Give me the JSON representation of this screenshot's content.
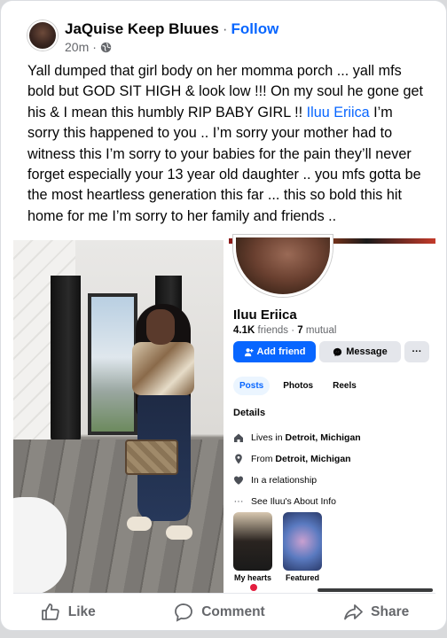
{
  "post": {
    "author": "JaQuise Keep Bluues",
    "separator": "·",
    "follow_label": "Follow",
    "time": "20m",
    "time_sep": "·",
    "text_before": "Yall dumped that girl body on her momma porch ... yall mfs bold but GOD SIT HIGH & look low !!! On my soul he gone get his & I mean this humbly RIP BABY GIRL !! ",
    "mention": "Iluu Eriica",
    "text_after": " I’m sorry this happened to you .. I’m sorry your mother had to witness this I’m sorry to your babies for the pain they’ll never forget especially your 13 year old daughter .. you mfs gotta be the most heartless generation this far ... this so bold this hit home for me I’m sorry to her family and friends .."
  },
  "profile_screenshot": {
    "name": "Iluu Eriica",
    "friends_count": "4.1K",
    "friends_label": "friends",
    "mutual_count": "7",
    "mutual_label": "mutual",
    "add_friend_label": "Add friend",
    "message_label": "Message",
    "more_label": "···",
    "tabs": [
      "Posts",
      "Photos",
      "Reels"
    ],
    "details_heading": "Details",
    "details": {
      "lives_prefix": "Lives in ",
      "lives_city": "Detroit, Michigan",
      "from_prefix": "From ",
      "from_city": "Detroit, Michigan",
      "relationship": "In a relationship",
      "about_link": "See Iluu's About Info"
    },
    "featured": [
      {
        "label": "My hearts"
      },
      {
        "label": "Featured"
      }
    ]
  },
  "actions": {
    "like": "Like",
    "comment": "Comment",
    "share": "Share"
  },
  "colors": {
    "accent": "#0866ff",
    "text": "#050505",
    "muted": "#65676b"
  },
  "icons": [
    "globe-icon",
    "thumbs-up-icon",
    "comment-icon",
    "share-icon",
    "home-icon",
    "location-pin-icon",
    "heart-icon",
    "dots-icon",
    "add-person-icon",
    "messenger-icon"
  ]
}
